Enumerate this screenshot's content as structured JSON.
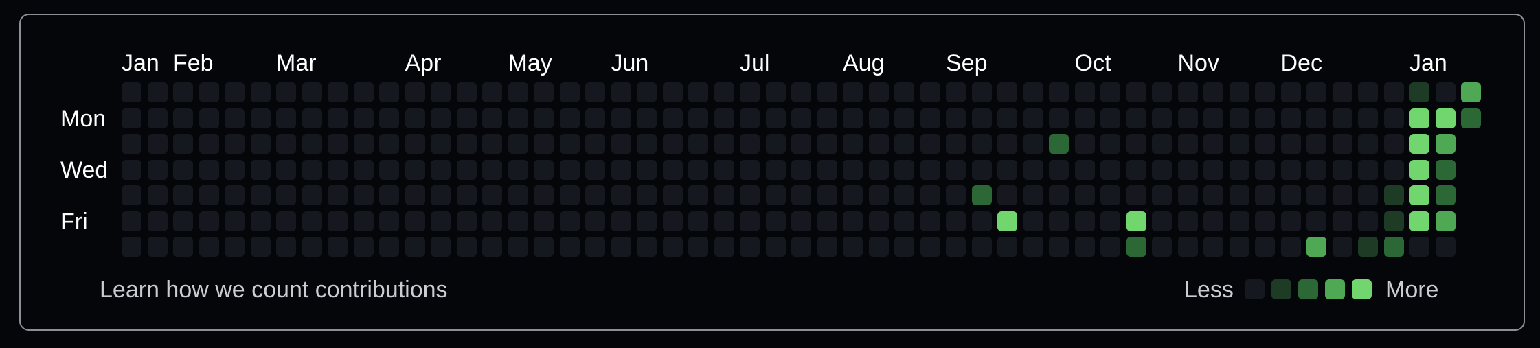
{
  "months": [
    "Jan",
    "Feb",
    "Mar",
    "Apr",
    "May",
    "Jun",
    "Jul",
    "Aug",
    "Sep",
    "Oct",
    "Nov",
    "Dec",
    "Jan"
  ],
  "month_week_index": [
    0,
    2,
    6,
    11,
    15,
    19,
    24,
    28,
    32,
    37,
    41,
    45,
    50
  ],
  "days": [
    "Mon",
    "Wed",
    "Fri"
  ],
  "day_row_index": [
    1,
    3,
    5
  ],
  "weeks": 53,
  "days_per_week": 7,
  "last_week_days": 2,
  "levels": {
    "0": "#15191f",
    "1": "#1e3c25",
    "2": "#2c6836",
    "3": "#4fa853",
    "4": "#72d66e"
  },
  "contributions": [
    {
      "week": 33,
      "day": 4,
      "level": 2
    },
    {
      "week": 34,
      "day": 5,
      "level": 4
    },
    {
      "week": 36,
      "day": 2,
      "level": 2
    },
    {
      "week": 39,
      "day": 5,
      "level": 4
    },
    {
      "week": 39,
      "day": 6,
      "level": 2
    },
    {
      "week": 46,
      "day": 6,
      "level": 3
    },
    {
      "week": 48,
      "day": 6,
      "level": 1
    },
    {
      "week": 49,
      "day": 4,
      "level": 1
    },
    {
      "week": 49,
      "day": 5,
      "level": 1
    },
    {
      "week": 49,
      "day": 6,
      "level": 2
    },
    {
      "week": 50,
      "day": 0,
      "level": 1
    },
    {
      "week": 50,
      "day": 1,
      "level": 4
    },
    {
      "week": 50,
      "day": 2,
      "level": 4
    },
    {
      "week": 50,
      "day": 3,
      "level": 4
    },
    {
      "week": 50,
      "day": 4,
      "level": 4
    },
    {
      "week": 50,
      "day": 5,
      "level": 4
    },
    {
      "week": 51,
      "day": 1,
      "level": 4
    },
    {
      "week": 51,
      "day": 2,
      "level": 3
    },
    {
      "week": 51,
      "day": 3,
      "level": 2
    },
    {
      "week": 51,
      "day": 4,
      "level": 2
    },
    {
      "week": 51,
      "day": 5,
      "level": 3
    },
    {
      "week": 52,
      "day": 0,
      "level": 3
    },
    {
      "week": 52,
      "day": 1,
      "level": 2
    }
  ],
  "footer": {
    "learn_link": "Learn how we count contributions",
    "less_label": "Less",
    "more_label": "More"
  }
}
